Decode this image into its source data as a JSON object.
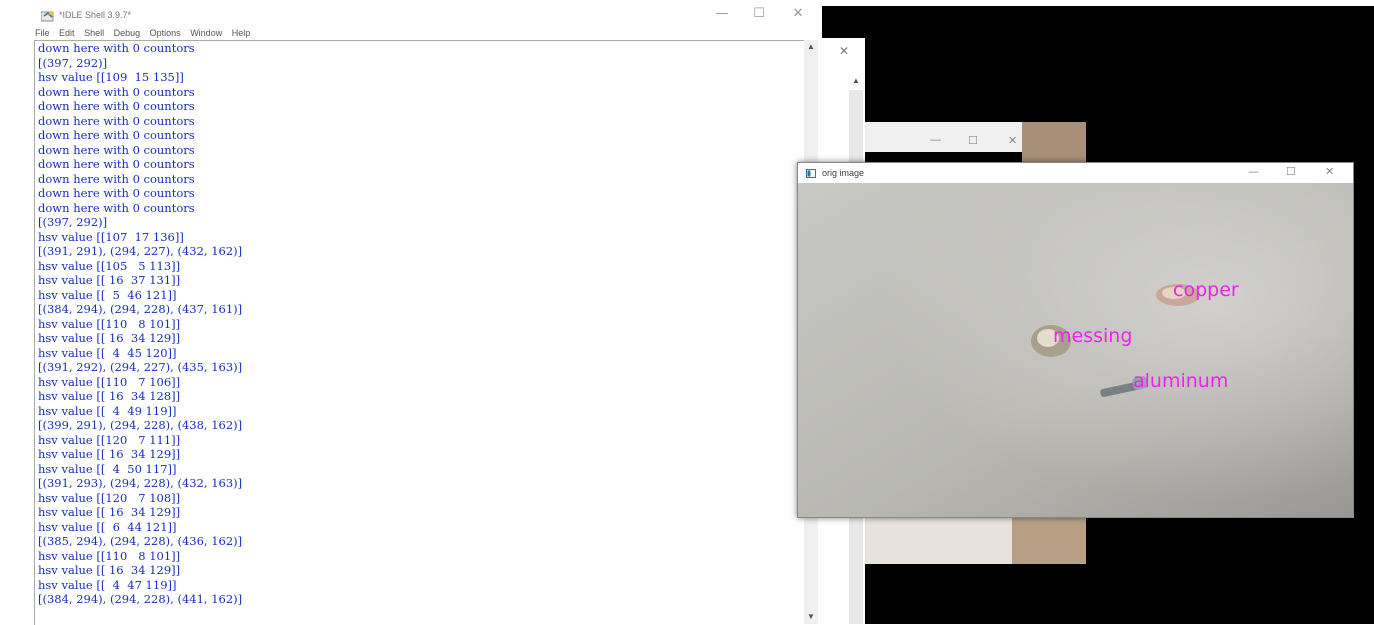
{
  "idle": {
    "title": "*IDLE Shell 3.9.7*",
    "menu": [
      "File",
      "Edit",
      "Shell",
      "Debug",
      "Options",
      "Window",
      "Help"
    ],
    "window_controls": {
      "minimize": "—",
      "maximize": "☐",
      "close": "✕"
    },
    "lines": [
      "down here with 0 countors",
      "[(397, 292)]",
      "hsv value [[109  15 135]]",
      "down here with 0 countors",
      "down here with 0 countors",
      "down here with 0 countors",
      "down here with 0 countors",
      "down here with 0 countors",
      "down here with 0 countors",
      "down here with 0 countors",
      "down here with 0 countors",
      "down here with 0 countors",
      "[(397, 292)]",
      "hsv value [[107  17 136]]",
      "[(391, 291), (294, 227), (432, 162)]",
      "hsv value [[105   5 113]]",
      "hsv value [[ 16  37 131]]",
      "hsv value [[  5  46 121]]",
      "[(384, 294), (294, 228), (437, 161)]",
      "hsv value [[110   8 101]]",
      "hsv value [[ 16  34 129]]",
      "hsv value [[  4  45 120]]",
      "[(391, 292), (294, 227), (435, 163)]",
      "hsv value [[110   7 106]]",
      "hsv value [[ 16  34 128]]",
      "hsv value [[  4  49 119]]",
      "[(399, 291), (294, 228), (438, 162)]",
      "hsv value [[120   7 111]]",
      "hsv value [[ 16  34 129]]",
      "hsv value [[  4  50 117]]",
      "[(391, 293), (294, 228), (432, 163)]",
      "hsv value [[120   7 108]]",
      "hsv value [[ 16  34 129]]",
      "hsv value [[  6  44 121]]",
      "[(385, 294), (294, 228), (436, 162)]",
      "hsv value [[110   8 101]]",
      "hsv value [[ 16  34 129]]",
      "hsv value [[  4  47 119]]",
      "[(384, 294), (294, 228), (441, 162)]"
    ],
    "text_color": "#1a2fb8"
  },
  "middle_window": {
    "close": "✕"
  },
  "third_window": {
    "minimize": "—",
    "maximize": "☐",
    "close": "✕"
  },
  "orig": {
    "title": "orig image",
    "window_controls": {
      "minimize": "—",
      "maximize": "☐",
      "close": "✕"
    },
    "labels": {
      "copper": "copper",
      "messing": "messing",
      "aluminum": "aluminum"
    },
    "label_color": "#ee22ee"
  }
}
